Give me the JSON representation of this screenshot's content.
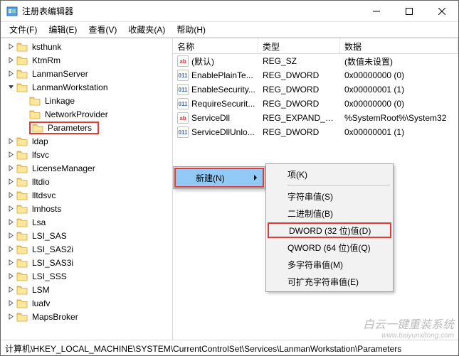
{
  "window": {
    "title": "注册表编辑器"
  },
  "menu": {
    "file": "文件(F)",
    "edit": "编辑(E)",
    "view": "查看(V)",
    "favorites": "收藏夹(A)",
    "help": "帮助(H)"
  },
  "tree": {
    "items": [
      {
        "label": "ksthunk",
        "depth": 1,
        "exp": ">"
      },
      {
        "label": "KtmRm",
        "depth": 1,
        "exp": ">"
      },
      {
        "label": "LanmanServer",
        "depth": 1,
        "exp": ">"
      },
      {
        "label": "LanmanWorkstation",
        "depth": 1,
        "exp": "v"
      },
      {
        "label": "Linkage",
        "depth": 2,
        "exp": ""
      },
      {
        "label": "NetworkProvider",
        "depth": 2,
        "exp": ""
      },
      {
        "label": "Parameters",
        "depth": 2,
        "exp": "",
        "hl": true
      },
      {
        "label": "ldap",
        "depth": 1,
        "exp": ">"
      },
      {
        "label": "lfsvc",
        "depth": 1,
        "exp": ">"
      },
      {
        "label": "LicenseManager",
        "depth": 1,
        "exp": ">"
      },
      {
        "label": "lltdio",
        "depth": 1,
        "exp": ">"
      },
      {
        "label": "lltdsvc",
        "depth": 1,
        "exp": ">"
      },
      {
        "label": "lmhosts",
        "depth": 1,
        "exp": ">"
      },
      {
        "label": "Lsa",
        "depth": 1,
        "exp": ">"
      },
      {
        "label": "LSI_SAS",
        "depth": 1,
        "exp": ">"
      },
      {
        "label": "LSI_SAS2i",
        "depth": 1,
        "exp": ">"
      },
      {
        "label": "LSI_SAS3i",
        "depth": 1,
        "exp": ">"
      },
      {
        "label": "LSI_SSS",
        "depth": 1,
        "exp": ">"
      },
      {
        "label": "LSM",
        "depth": 1,
        "exp": ">"
      },
      {
        "label": "luafv",
        "depth": 1,
        "exp": ">"
      },
      {
        "label": "MapsBroker",
        "depth": 1,
        "exp": ">"
      }
    ]
  },
  "list": {
    "headers": {
      "name": "名称",
      "type": "类型",
      "data": "数据"
    },
    "rows": [
      {
        "icon": "str",
        "name": "(默认)",
        "type": "REG_SZ",
        "data": "(数值未设置)"
      },
      {
        "icon": "bin",
        "name": "EnablePlainTe...",
        "type": "REG_DWORD",
        "data": "0x00000000 (0)"
      },
      {
        "icon": "bin",
        "name": "EnableSecurity...",
        "type": "REG_DWORD",
        "data": "0x00000001 (1)"
      },
      {
        "icon": "bin",
        "name": "RequireSecurit...",
        "type": "REG_DWORD",
        "data": "0x00000000 (0)"
      },
      {
        "icon": "str",
        "name": "ServiceDll",
        "type": "REG_EXPAND_SZ",
        "data": "%SystemRoot%\\System32"
      },
      {
        "icon": "bin",
        "name": "ServiceDllUnlo...",
        "type": "REG_DWORD",
        "data": "0x00000001 (1)"
      }
    ]
  },
  "context": {
    "new": "新建(N)",
    "sub": {
      "key": "项(K)",
      "string": "字符串值(S)",
      "binary": "二进制值(B)",
      "dword": "DWORD (32 位)值(D)",
      "qword": "QWORD (64 位)值(Q)",
      "multi": "多字符串值(M)",
      "expand": "可扩充字符串值(E)"
    }
  },
  "status": {
    "path": "计算机\\HKEY_LOCAL_MACHINE\\SYSTEM\\CurrentControlSet\\Services\\LanmanWorkstation\\Parameters"
  },
  "watermark": {
    "main": "白云一键重装系统",
    "sub": "www.baiyunxitong.com"
  }
}
